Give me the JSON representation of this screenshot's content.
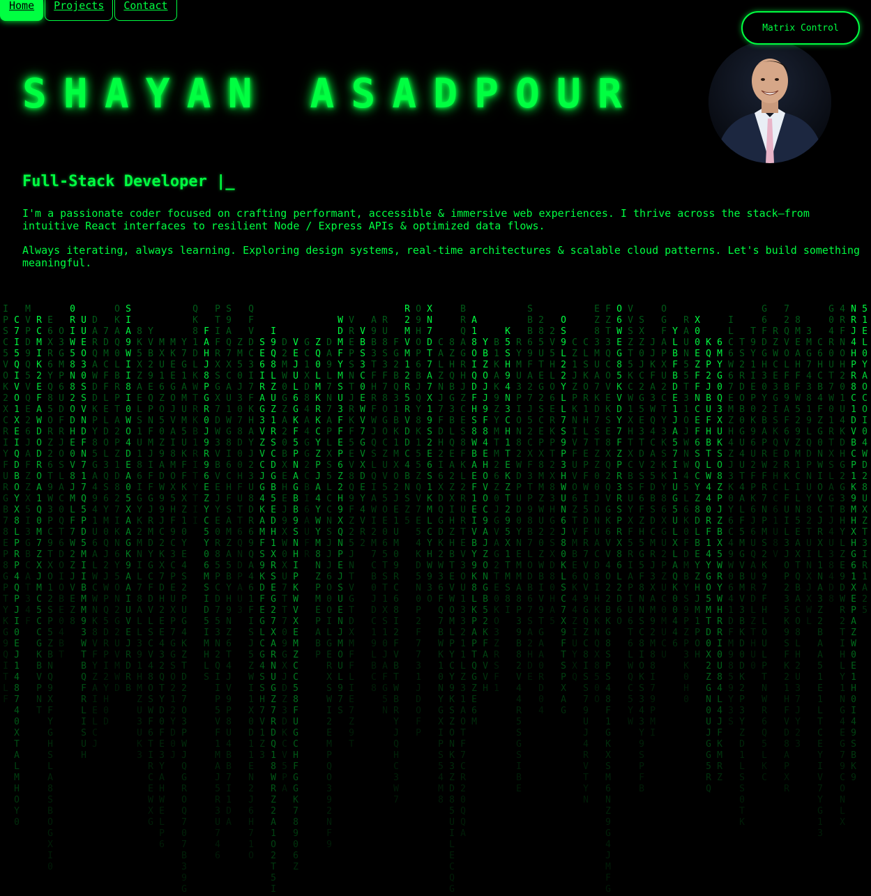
{
  "nav": {
    "items": [
      {
        "label": "Home",
        "active": true
      },
      {
        "label": "Projects",
        "active": false
      },
      {
        "label": "Contact",
        "active": false
      }
    ]
  },
  "matrix_control": {
    "label": "Matrix Control"
  },
  "hero": {
    "name": "SHAYAN ASADPOUR",
    "role": "Full-Stack Developer |_",
    "bio": [
      "I'm a passionate coder focused on crafting performant, accessible & immersive web experiences. I thrive across the stack—from intuitive React interfaces to resilient Node / Express APIs & optimized data flows.",
      "Always iterating, always learning. Exploring design systems, real-time architectures & scalable cloud patterns. Let's build something meaningful."
    ]
  },
  "colors": {
    "accent": "#00ff41",
    "background": "#000000"
  },
  "icons": {
    "avatar": "profile-photo"
  }
}
